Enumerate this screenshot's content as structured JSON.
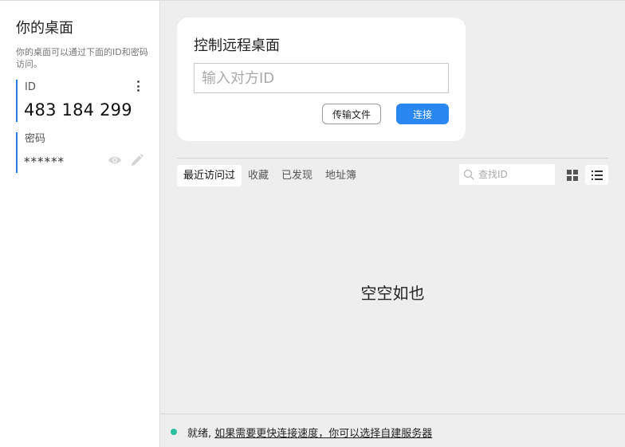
{
  "sidebar": {
    "title": "你的桌面",
    "description": "你的桌面可以通过下面的ID和密码访问。",
    "id_label": "ID",
    "id_value": "483 184 299",
    "password_label": "密码",
    "password_value": "******"
  },
  "connect_card": {
    "title": "控制远程桌面",
    "input_placeholder": "输入对方ID",
    "input_value": "",
    "transfer_button": "传输文件",
    "connect_button": "连接"
  },
  "tabs": [
    {
      "label": "最近访问过",
      "active": true
    },
    {
      "label": "收藏",
      "active": false
    },
    {
      "label": "已发现",
      "active": false
    },
    {
      "label": "地址簿",
      "active": false
    }
  ],
  "search": {
    "placeholder": "查找ID",
    "value": ""
  },
  "empty_text": "空空如也",
  "status": {
    "ready_text": "就绪, ",
    "link_text": "如果需要更快连接速度，你可以选择自建服务器"
  },
  "colors": {
    "accent": "#2a86f0",
    "id_bar": "#2a7de1",
    "status_ok": "#2bbf9b"
  }
}
